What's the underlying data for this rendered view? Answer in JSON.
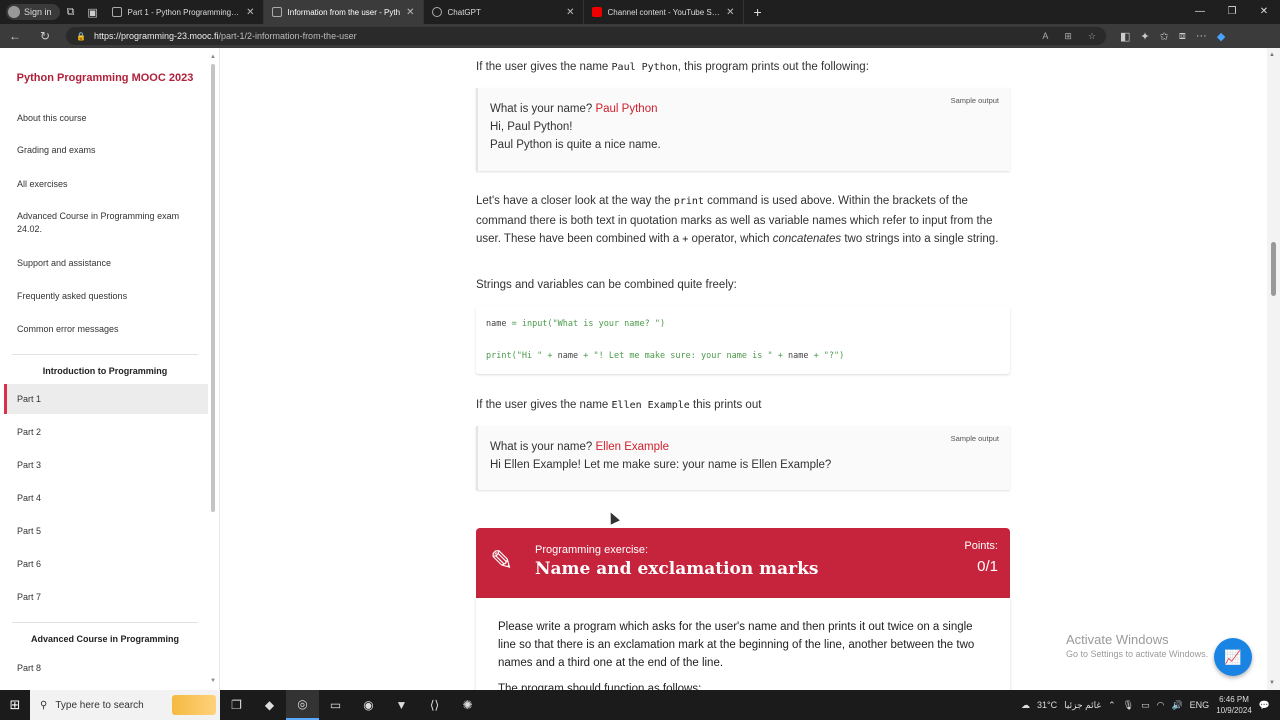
{
  "browser": {
    "signin_label": "Sign in",
    "tabs": [
      {
        "label": "Part 1 - Python Programming MO",
        "icon": "page-icon"
      },
      {
        "label": "Information from the user - Pyth",
        "icon": "page-icon",
        "active": true
      },
      {
        "label": "ChatGPT",
        "icon": "chatgpt-icon"
      },
      {
        "label": "Channel content - YouTube Studio",
        "icon": "youtube-icon"
      }
    ],
    "url_host": "https://programming-23.mooc.fi",
    "url_path": "/part-1/2-information-from-the-user"
  },
  "sidebar": {
    "title": "Python Programming MOOC 2023",
    "items": [
      "About this course",
      "Grading and exams",
      "All exercises",
      "Advanced Course in Programming exam 24.02.",
      "Support and assistance",
      "Frequently asked questions",
      "Common error messages"
    ],
    "section1": "Introduction to Programming",
    "parts1": [
      "Part 1",
      "Part 2",
      "Part 3",
      "Part 4",
      "Part 5",
      "Part 6",
      "Part 7"
    ],
    "section2": "Advanced Course in Programming",
    "parts2": [
      "Part 8"
    ]
  },
  "content": {
    "p1_pre": "If the user gives the name",
    "p1_code": "Paul Python",
    "p1_post": ", this program prints out the following:",
    "sample_label": "Sample output",
    "sample1": {
      "prompt": "What is your name?",
      "input": "Paul Python",
      "line2": "Hi, Paul Python!",
      "line3": "Paul Python is quite a nice name."
    },
    "p2_a": "Let's have a closer look at the way the",
    "p2_code": "print",
    "p2_b": "command is used above. Within the brackets of the command there is both text in quotation marks as well as variable names which refer to input from the user. These have been combined with a",
    "p2_plus": "+",
    "p2_c": "operator, which",
    "p2_em": "concatenates",
    "p2_d": "two strings into a single string.",
    "p3": "Strings and variables can be combined quite freely:",
    "code_line1_var": "name",
    "code_line1_rest": " = input(\"What is your name? \")",
    "code_line2_a": "print(\"Hi \" + ",
    "code_line2_var1": "name",
    "code_line2_b": " + \"! Let me make sure: your name is \" + ",
    "code_line2_var2": "name",
    "code_line2_c": " + \"?\")",
    "p4_pre": "If the user gives the name",
    "p4_code": "Ellen Example",
    "p4_post": "this prints out",
    "sample2": {
      "prompt": "What is your name?",
      "input": "Ellen Example",
      "line2": "Hi Ellen Example! Let me make sure: your name is Ellen Example?"
    },
    "exercise": {
      "kicker": "Programming exercise:",
      "title": "Name and exclamation marks",
      "points_label": "Points:",
      "points_value": "0/1",
      "body": "Please write a program which asks for the user's name and then prints it out twice on a single line so that there is an exclamation mark at the beginning of the line, another between the two names and a third one at the end of the line.",
      "cut_line": "The program should function as follows:"
    }
  },
  "watermark": {
    "line1": "Activate Windows",
    "line2": "Go to Settings to activate Windows."
  },
  "taskbar": {
    "search_placeholder": "Type here to search",
    "weather": "31°C",
    "weather_desc": "غائم جزئيا",
    "lang": "ENG",
    "time": "6:46 PM",
    "date": "10/9/2024"
  },
  "colors": {
    "brand_red": "#c6243d",
    "highlight_red": "#d0202d",
    "code_green": "#4b9b4b"
  }
}
